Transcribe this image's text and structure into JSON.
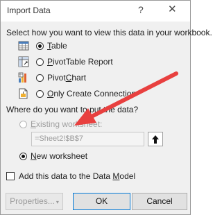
{
  "window": {
    "title": "Import Data",
    "help_glyph": "?",
    "close_glyph": "✕"
  },
  "view_section": {
    "prompt": "Select how you want to view this data in your workbook.",
    "options": [
      {
        "accel": "T",
        "rest": "able",
        "selected": true
      },
      {
        "accel": "P",
        "rest": "ivotTable Report",
        "selected": false
      },
      {
        "prefix": "Pivot",
        "accel": "C",
        "rest": "hart",
        "selected": false
      },
      {
        "accel": "O",
        "rest": "nly Create Connection",
        "selected": false
      }
    ]
  },
  "location_section": {
    "prompt": "Where do you want to put the data?",
    "existing_label": "Existing worksheet:",
    "existing_accel": "E",
    "existing_rest": "xisting worksheet:",
    "range_value": "=Sheet2!$B$7",
    "collapse_glyph": "🡅",
    "new_accel": "N",
    "new_rest": "ew worksheet",
    "new_selected": true
  },
  "data_model": {
    "prefix": "Add this data to the Data ",
    "accel": "M",
    "rest": "odel",
    "checked": false
  },
  "buttons": {
    "properties": "Properties...",
    "properties_arrow": "▾",
    "ok": "OK",
    "cancel": "Cancel"
  },
  "colors": {
    "annotation_arrow": "#e8403f",
    "accent": "#0078d7"
  }
}
